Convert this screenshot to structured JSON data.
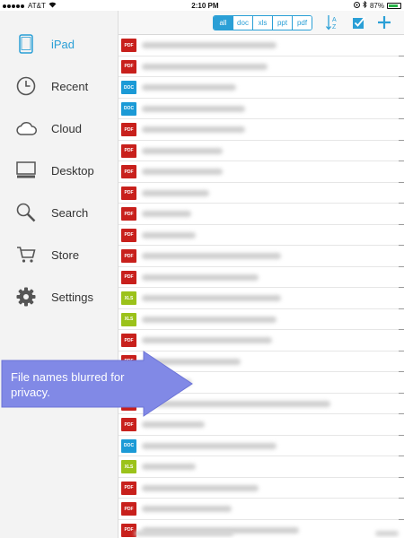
{
  "status_bar": {
    "carrier": "AT&T",
    "time": "2:10 PM",
    "battery": "87%",
    "battery_level": 0.87
  },
  "sidebar": {
    "items": [
      {
        "label": "iPad",
        "icon": "tablet-icon",
        "active": true
      },
      {
        "label": "Recent",
        "icon": "clock-icon",
        "active": false
      },
      {
        "label": "Cloud",
        "icon": "cloud-icon",
        "active": false
      },
      {
        "label": "Desktop",
        "icon": "desktop-icon",
        "active": false
      },
      {
        "label": "Search",
        "icon": "search-icon",
        "active": false
      },
      {
        "label": "Store",
        "icon": "cart-icon",
        "active": false
      },
      {
        "label": "Settings",
        "icon": "gear-icon",
        "active": false
      }
    ]
  },
  "toolbar": {
    "filters": [
      "all",
      "doc",
      "xls",
      "ppt",
      "pdf"
    ],
    "selected_filter": "all",
    "icons": [
      "sort-icon",
      "select-icon",
      "add-icon"
    ]
  },
  "files": [
    {
      "type": "PDF"
    },
    {
      "type": "PDF"
    },
    {
      "type": "DOC"
    },
    {
      "type": "DOC"
    },
    {
      "type": "PDF"
    },
    {
      "type": "PDF"
    },
    {
      "type": "PDF"
    },
    {
      "type": "PDF"
    },
    {
      "type": "PDF"
    },
    {
      "type": "PDF"
    },
    {
      "type": "PDF"
    },
    {
      "type": "PDF"
    },
    {
      "type": "XLS"
    },
    {
      "type": "XLS"
    },
    {
      "type": "PDF"
    },
    {
      "type": "PDF"
    },
    {
      "type": "PDF"
    },
    {
      "type": "PDF"
    },
    {
      "type": "PDF"
    },
    {
      "type": "DOC"
    },
    {
      "type": "XLS"
    },
    {
      "type": "PDF"
    },
    {
      "type": "PDF"
    },
    {
      "type": "PDF"
    }
  ],
  "callout": {
    "text": "File names blurred for privacy."
  }
}
